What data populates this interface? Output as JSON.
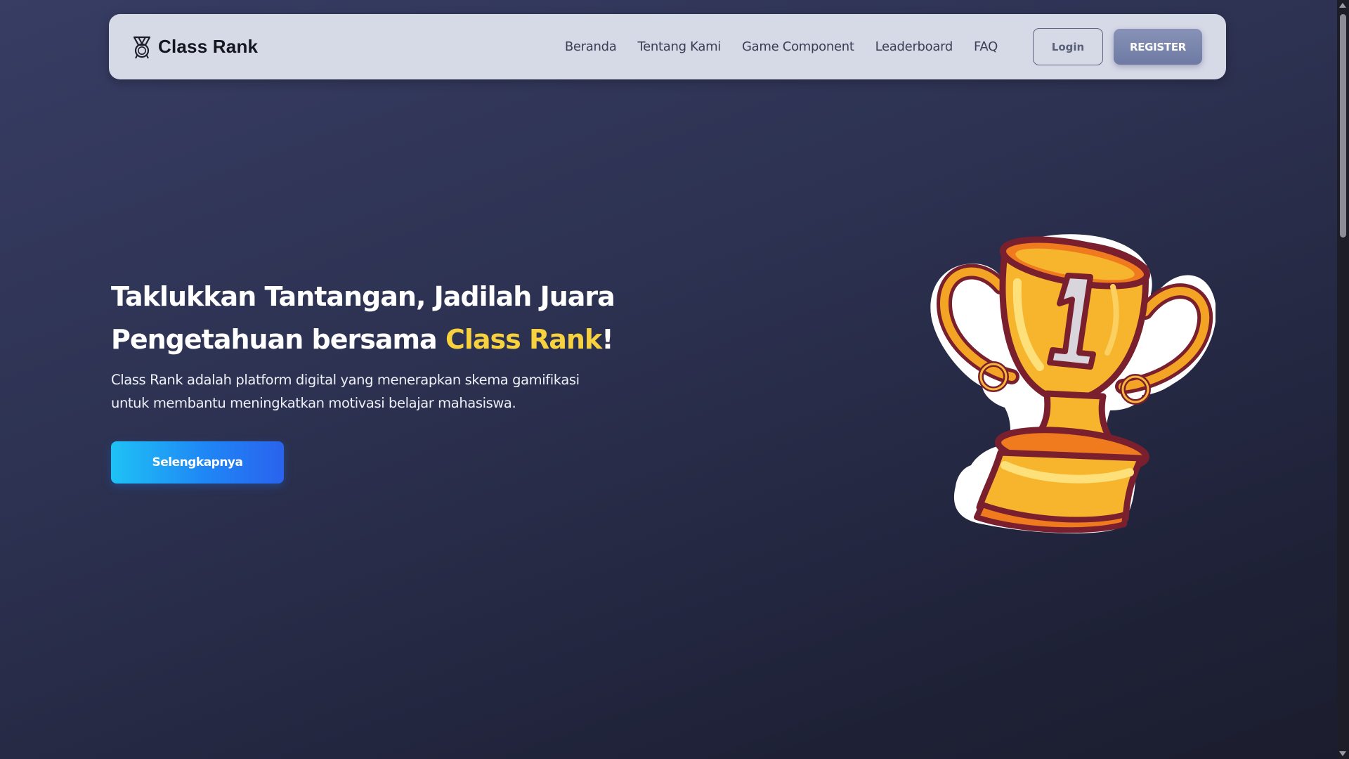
{
  "navbar": {
    "brand": "Class Rank",
    "brand_icon": "medal-trophy-icon",
    "links": [
      "Beranda",
      "Tentang Kami",
      "Game Component",
      "Leaderboard",
      "FAQ"
    ],
    "login_label": "Login",
    "register_label": "REGISTER"
  },
  "hero": {
    "title_part1": "Taklukkan Tantangan, Jadilah Juara Pengetahuan bersama ",
    "title_accent": "Class Rank",
    "title_end": "!",
    "description": "Class Rank adalah platform digital yang menerapkan skema gamifikasi untuk membantu meningkatkan motivasi belajar mahasiswa.",
    "cta_label": "Selengkapnya",
    "illustration": "trophy-number-1-icon"
  },
  "colors": {
    "background_top": "#373d63",
    "background_bottom": "#1b1d2e",
    "navbar_bg": "#d6d9e6",
    "accent_yellow": "#f7d23e",
    "cta_blue": "#1f86f5",
    "register_bg": "#7a85ad"
  }
}
